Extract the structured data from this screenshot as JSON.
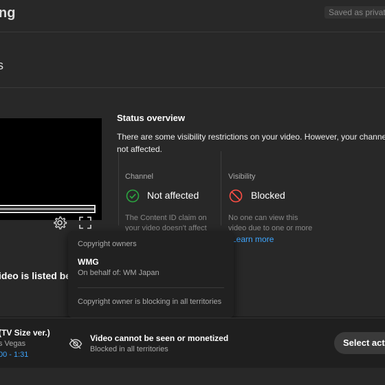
{
  "topbar": {
    "title_fragment": "ng",
    "saved_status": "Saved as private"
  },
  "header": {
    "title_fragment": "s"
  },
  "player": {
    "progress_fraction": 1.0,
    "settings_icon": "gear-icon",
    "fullscreen_icon": "fullscreen-icon"
  },
  "status": {
    "title": "Status overview",
    "description": "There are some visibility restrictions on your video. However, your channel is not affected.",
    "channel": {
      "label": "Channel",
      "status": "Not affected",
      "icon": "check-circle-icon",
      "text": "The Content ID claim on your video doesn't affect your channel."
    },
    "visibility": {
      "label": "Visibility",
      "status": "Blocked",
      "icon": "blocked-icon",
      "text": "No one can view this video due to one or more"
    },
    "learn_more": "Learn more"
  },
  "listed_text": "ideo is listed belo",
  "popup": {
    "heading": "Copyright owners",
    "owner": "WMG",
    "on_behalf": "On behalf of: WM Japan",
    "blocking": "Copyright owner is blocking in all territories"
  },
  "claim": {
    "title": "(TV Size ver.)",
    "artist": "s Vegas",
    "time": "00 - 1:31",
    "impact_icon": "eye-off-icon",
    "impact_title": "Video cannot be seen or monetized",
    "impact_sub": "Blocked in all territories",
    "action_label": "Select actions"
  },
  "colors": {
    "background": "#282828",
    "link": "#3ea6ff",
    "check": "#2ba640",
    "blocked": "#ff4e45"
  }
}
